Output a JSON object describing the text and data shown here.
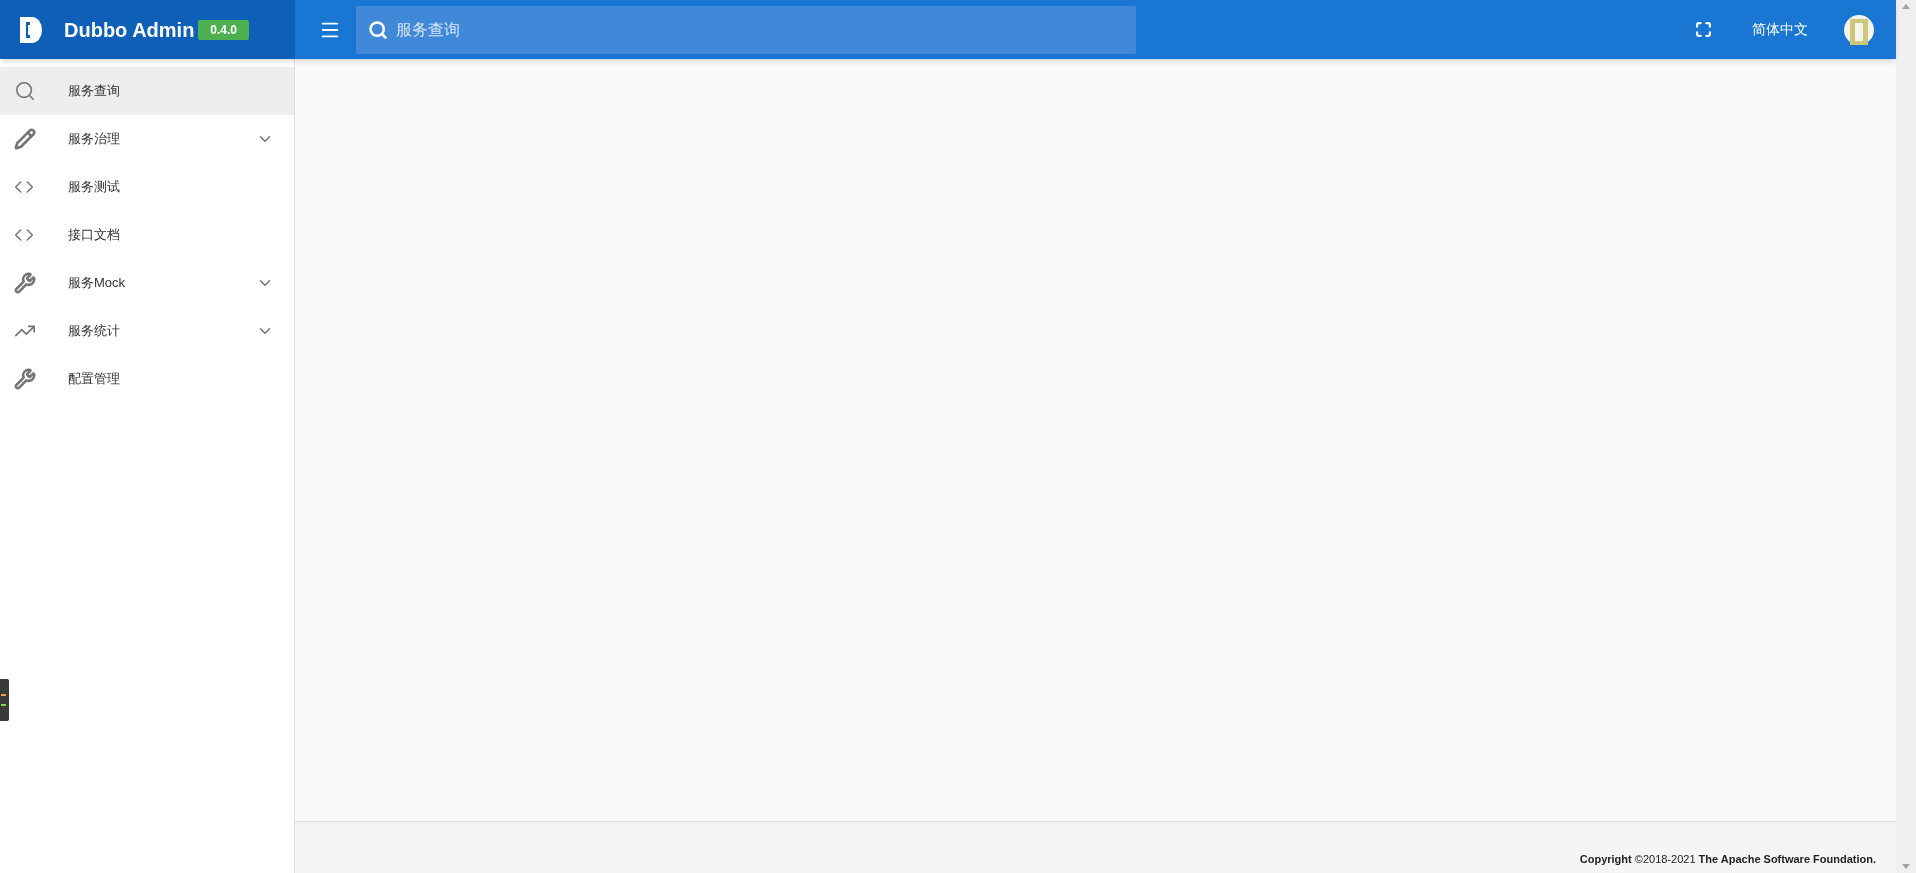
{
  "brand": {
    "name": "Dubbo Admin",
    "version": "0.4.0"
  },
  "search": {
    "placeholder": "服务查询"
  },
  "language": "简体中文",
  "sidebar": {
    "items": [
      {
        "label": "服务查询",
        "kind": "search",
        "selected": true,
        "expandable": false
      },
      {
        "label": "服务治理",
        "kind": "pencil",
        "selected": false,
        "expandable": true
      },
      {
        "label": "服务测试",
        "kind": "code",
        "selected": false,
        "expandable": false
      },
      {
        "label": "接口文档",
        "kind": "code",
        "selected": false,
        "expandable": false
      },
      {
        "label": "服务Mock",
        "kind": "wrench",
        "selected": false,
        "expandable": true
      },
      {
        "label": "服务统计",
        "kind": "trend",
        "selected": false,
        "expandable": true
      },
      {
        "label": "配置管理",
        "kind": "wrench",
        "selected": false,
        "expandable": false
      }
    ]
  },
  "footer": "**Copyright** ©2018-2021 **The Apache Software Foundation.**"
}
